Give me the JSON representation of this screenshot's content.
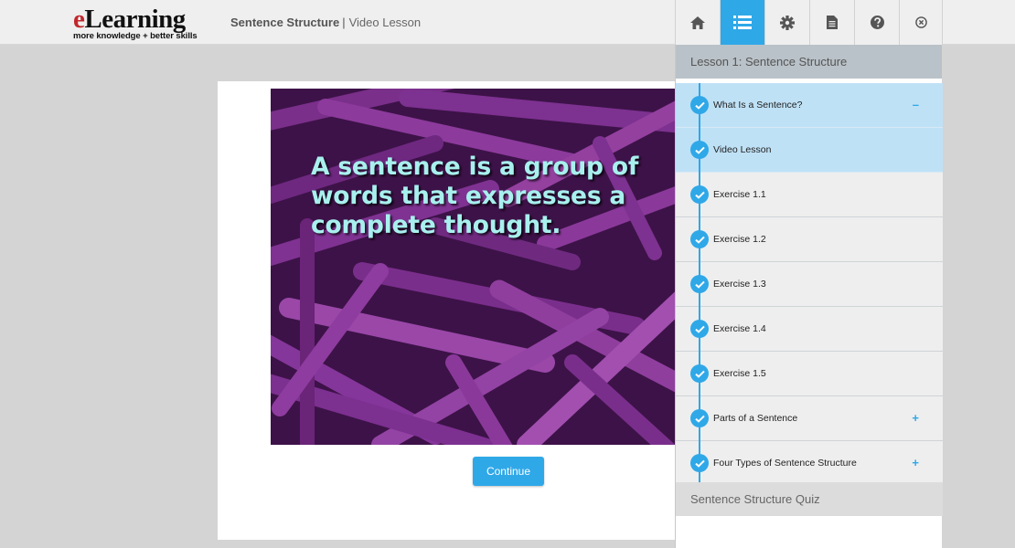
{
  "header": {
    "logo_main": "Learning",
    "logo_e": "e",
    "logo_tagline": "more knowledge + better skills",
    "course_title": "Sentence Structure",
    "separator": "|",
    "page_title": "Video Lesson"
  },
  "toolbar": {
    "buttons": [
      {
        "icon": "home-icon",
        "active": false
      },
      {
        "icon": "list-icon",
        "active": true
      },
      {
        "icon": "gear-icon",
        "active": false
      },
      {
        "icon": "document-icon",
        "active": false
      },
      {
        "icon": "help-icon",
        "active": false
      },
      {
        "icon": "close-icon",
        "active": false
      }
    ]
  },
  "video": {
    "text": "A sentence is a group of words that expresses a complete thought."
  },
  "content": {
    "continue_label": "Continue"
  },
  "sidebar": {
    "lesson_title": "Lesson 1: Sentence Structure",
    "items": [
      {
        "label": "What Is a Sentence?",
        "toggle": "–",
        "highlighted": true
      },
      {
        "label": "Video Lesson",
        "toggle": "",
        "highlighted": true
      },
      {
        "label": "Exercise 1.1",
        "toggle": "",
        "highlighted": false
      },
      {
        "label": "Exercise 1.2",
        "toggle": "",
        "highlighted": false
      },
      {
        "label": "Exercise 1.3",
        "toggle": "",
        "highlighted": false
      },
      {
        "label": "Exercise 1.4",
        "toggle": "",
        "highlighted": false
      },
      {
        "label": "Exercise 1.5",
        "toggle": "",
        "highlighted": false
      },
      {
        "label": "Parts of a Sentence",
        "toggle": "+",
        "highlighted": false
      },
      {
        "label": "Four Types of Sentence Structure",
        "toggle": "+",
        "highlighted": false
      }
    ],
    "quiz_label": "Sentence Structure Quiz"
  },
  "colors": {
    "accent": "#2fa8e8",
    "highlight": "#bfe1f6",
    "logo_red": "#c0282d"
  }
}
